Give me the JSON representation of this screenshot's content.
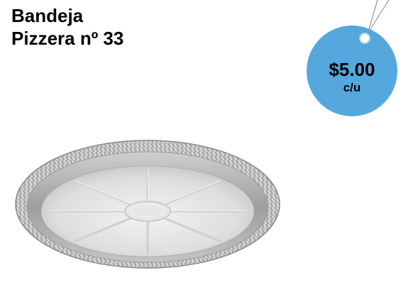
{
  "product": {
    "title_line1": "Bandeja",
    "title_line2": "Pizzera nº 33",
    "image": "aluminum-pizza-tray"
  },
  "price_tag": {
    "price": "$5.00",
    "unit": "c/u",
    "color": "#55a8dd"
  }
}
